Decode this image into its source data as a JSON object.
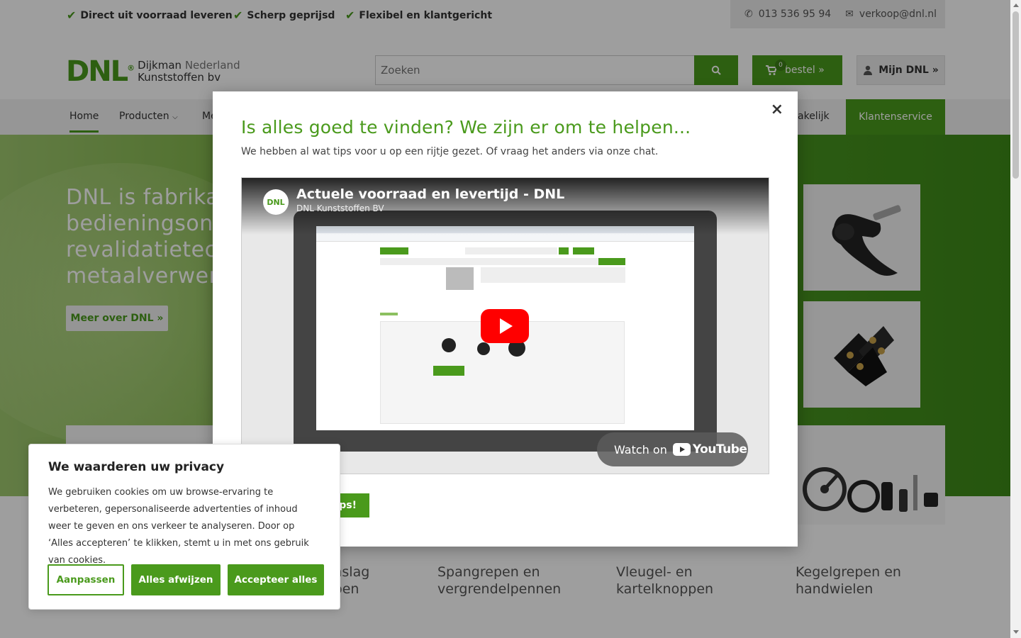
{
  "usp": [
    {
      "label": "Direct uit voorraad leveren"
    },
    {
      "label": "Scherp geprijsd"
    },
    {
      "label": "Flexibel en klantgericht"
    }
  ],
  "contact": {
    "phone": "013 536 95 94",
    "email": "verkoop@dnl.nl"
  },
  "logo": {
    "mark": "DNL",
    "reg": "®",
    "line1a": "Dijkman",
    "line1b": " Nederland",
    "line2": "Kunststoffen bv"
  },
  "search": {
    "placeholder": "Zoeken"
  },
  "order": {
    "count": "0",
    "label": "bestel »"
  },
  "account": {
    "label": "Mijn DNL »"
  },
  "nav": {
    "home": "Home",
    "products": "Producten",
    "more_partial": "Me",
    "partial_right": "akelijk",
    "service": "Klantenservice"
  },
  "hero": {
    "line1": "DNL is fabrikant",
    "line2": "bedieningsonde",
    "line3": "revalidatietechn",
    "line4": "metaalverwerki",
    "button": "Meer over DNL »"
  },
  "categories": [
    {
      "line1": "n inslag",
      "line2": "oppen"
    },
    {
      "line1": "Spangrepen en",
      "line2": "vergrendelpennen"
    },
    {
      "line1": "Vleugel- en",
      "line2": "kartelknoppen"
    },
    {
      "line1": "Kegelgrepen en",
      "line2": "handwielen"
    }
  ],
  "modal": {
    "close": "×",
    "title": "Is alles goed te vinden? We zijn er om te helpen...",
    "subtitle": "We hebben al wat tips voor u op een rijtje gezet. Of vraag het anders via onze chat.",
    "cta_partial": "ips!",
    "video": {
      "channel_logo": "DNL",
      "title": "Actuele voorraad en levertijd - DNL",
      "channel": "DNL Kunststoffen BV",
      "watch_on": "Watch on",
      "youtube": "YouTube"
    }
  },
  "cookie": {
    "title": "We waarderen uw privacy",
    "text": "We gebruiken cookies om uw browse-ervaring te verbeteren, gepersonaliseerde advertenties of inhoud weer te geven en ons verkeer te analyseren. Door op ‘Alles accepteren’ te klikken, stemt u in met ons gebruik van cookies.",
    "customize": "Aanpassen",
    "reject": "Alles afwijzen",
    "accept": "Accepteer alles"
  },
  "colors": {
    "brand": "#4a9a1c"
  }
}
